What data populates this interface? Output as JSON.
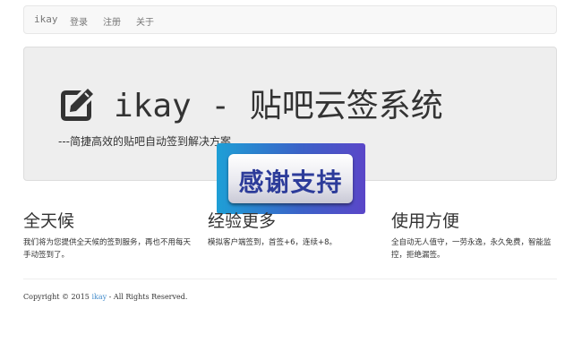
{
  "navbar": {
    "brand": "ikay",
    "links": [
      "登录",
      "注册",
      "关于"
    ]
  },
  "hero": {
    "title": "ikay - 贴吧云签系统",
    "subtitle": "---简捷高效的贴吧自动签到解决方案",
    "icon": "edit-icon"
  },
  "badge": {
    "text": "感谢支持"
  },
  "features": [
    {
      "title": "全天候",
      "description": "我们将为您提供全天候的签到服务，再也不用每天手动签到了。"
    },
    {
      "title": "经验更多",
      "description": "模拟客户端签到，首签+6，连续+8。"
    },
    {
      "title": "使用方便",
      "description": "全自动无人值守，一劳永逸，永久免费，智能监控，拒绝漏签。"
    }
  ],
  "footer": {
    "prefix": "Copyright © 2015 ",
    "link": "ikay",
    "suffix": " - All Rights Reserved."
  },
  "colors": {
    "link": "#428bca",
    "jumbotron_bg": "#eeeeee",
    "navbar_bg": "#f8f8f8"
  }
}
